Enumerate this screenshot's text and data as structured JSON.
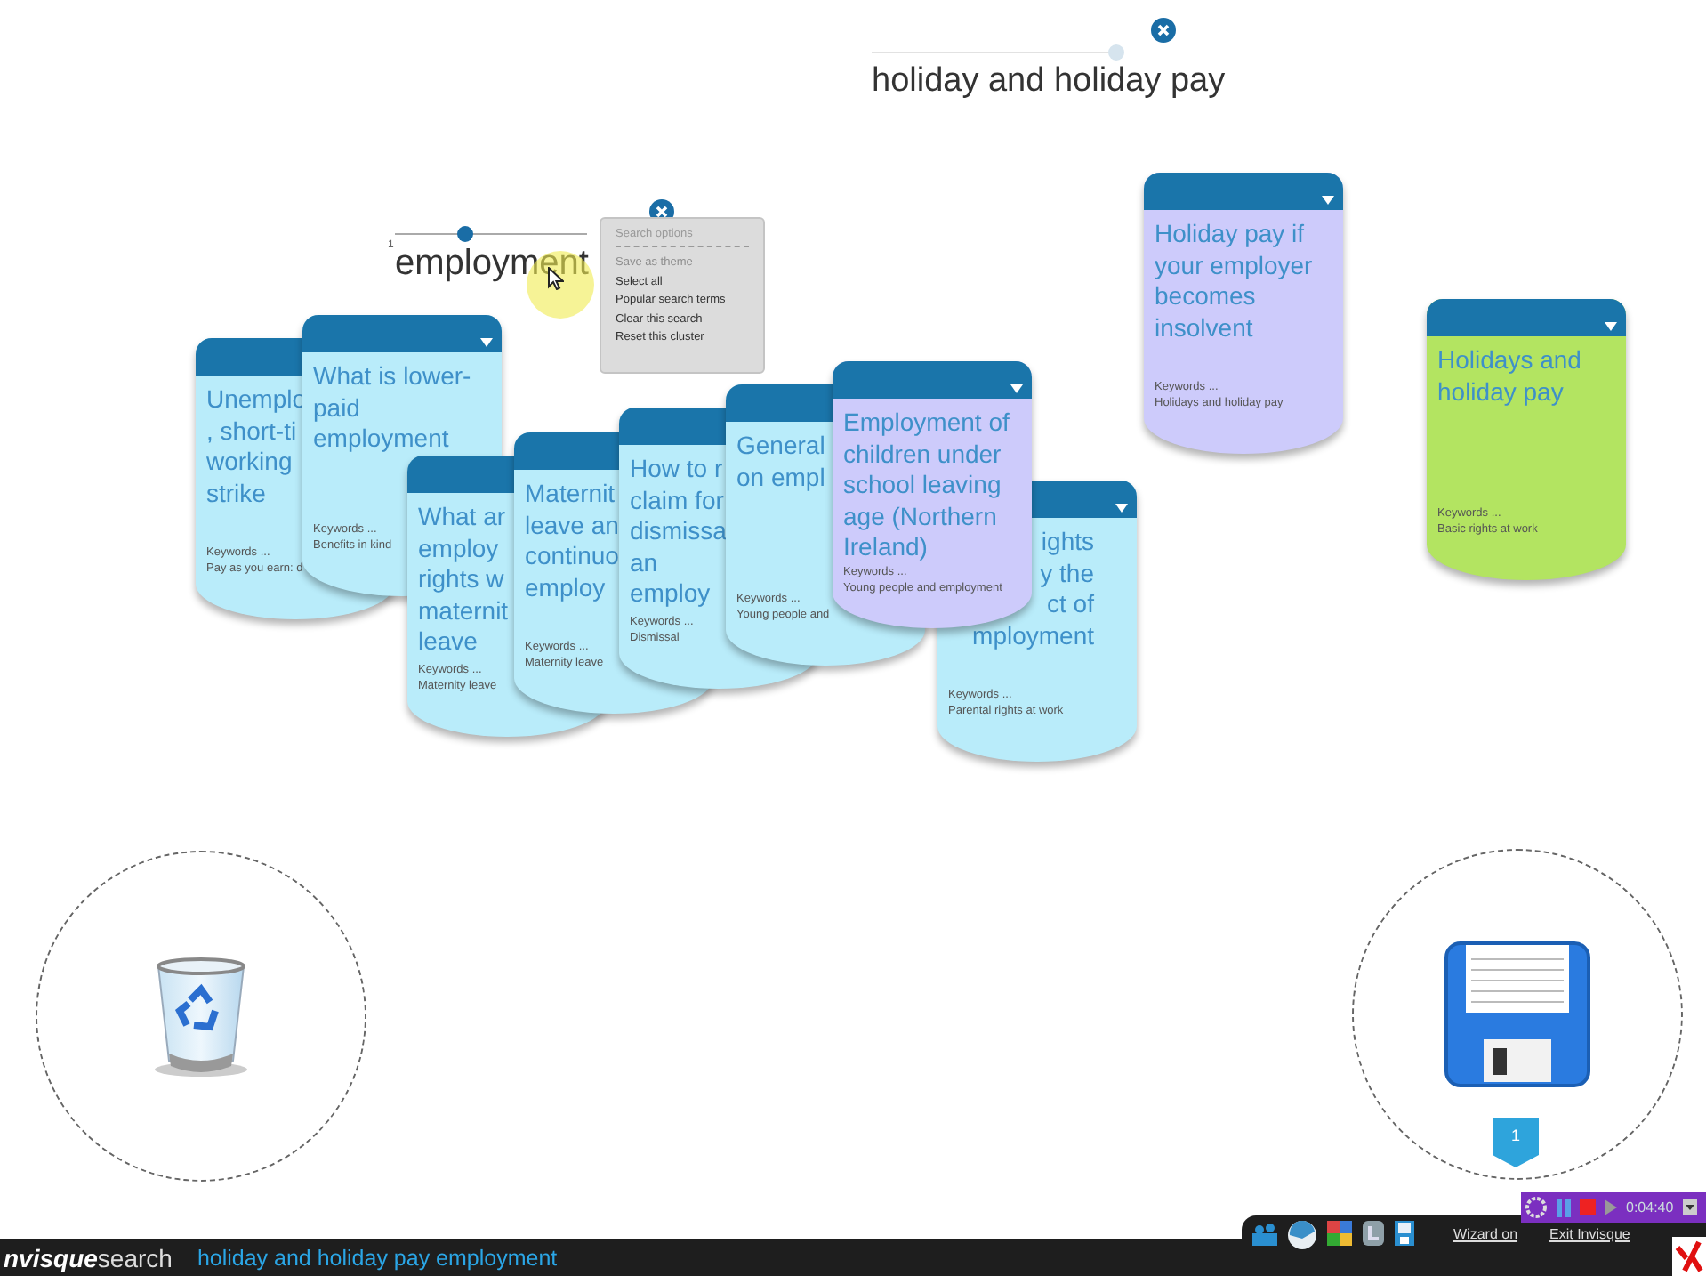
{
  "clusters": [
    {
      "query": "holiday and holiday pay",
      "level": 0.98
    },
    {
      "query": "employment",
      "level": 0.36,
      "slider_label": "1"
    }
  ],
  "search_options": {
    "title": "Search options",
    "items": [
      {
        "label": "Save as theme",
        "disabled": true
      },
      {
        "label": "Select all",
        "disabled": false
      },
      {
        "label": "Popular search terms",
        "disabled": false
      },
      {
        "label": "Clear this search",
        "disabled": false
      },
      {
        "label": "Reset this cluster",
        "disabled": false
      }
    ]
  },
  "cards": [
    {
      "title": "Unemplo\n, short-ti\nworking\nstrike",
      "keywords_label": "Keywords ...",
      "keywords": "Pay as you earn: d",
      "color": "#b9ecfa"
    },
    {
      "title": "What is lower-\npaid\nemployment",
      "keywords_label": "Keywords ...",
      "keywords": "Benefits in kind",
      "color": "#b9ecfa"
    },
    {
      "title": "What ar\nemploy\nrights w\nmaternit\nleave",
      "keywords_label": "Keywords ...",
      "keywords": "Maternity leave",
      "color": "#b9ecfa"
    },
    {
      "title": "Maternit\nleave an\ncontinuo\nemploy",
      "keywords_label": "Keywords ...",
      "keywords": "Maternity leave",
      "color": "#b9ecfa"
    },
    {
      "title": "How to r\nclaim for\ndismissa\nan\nemploy",
      "keywords_label": "Keywords ...",
      "keywords": "Dismissal",
      "color": "#b9ecfa"
    },
    {
      "title": "General\non empl",
      "keywords_label": "Keywords ...",
      "keywords": "Young people and",
      "color": "#b9ecfa"
    },
    {
      "title": "Employment of\nchildren under\nschool leaving\nage (Northern\nIreland)",
      "keywords_label": "Keywords ...",
      "keywords": "Young people and employment",
      "color": "#cdcbfb"
    },
    {
      "title": "ights\ny the\nct of\nmployment",
      "keywords_label": "Keywords ...",
      "keywords": "Parental rights at work",
      "color": "#b9ecfa"
    },
    {
      "title": "Holiday pay if\nyour employer\nbecomes\ninsolvent",
      "keywords_label": "Keywords ...",
      "keywords": "Holidays and holiday pay",
      "color": "#cdcbfb"
    },
    {
      "title": "Holidays and\nholiday pay",
      "keywords_label": "Keywords ...",
      "keywords": "Basic rights at work",
      "color": "#b3e461"
    }
  ],
  "drop_zones": [
    {
      "kind": "trash"
    },
    {
      "kind": "save",
      "badge": "1"
    }
  ],
  "bottom_bar": {
    "brand_bold": "nvisque",
    "brand_light": "search",
    "breadcrumb": "holiday and holiday pay employment",
    "links": [
      "Wizard on",
      "Exit Invisque"
    ]
  },
  "recorder": {
    "time": "0:04:40"
  }
}
